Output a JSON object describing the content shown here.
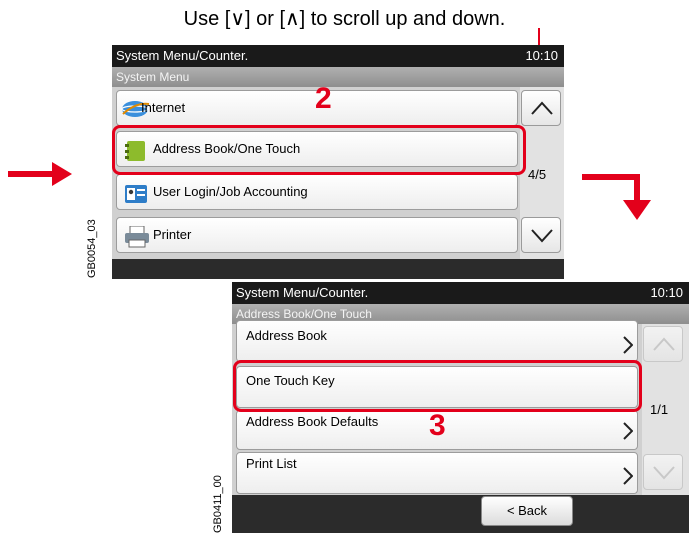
{
  "instruction": "Use [∨] or [∧] to scroll up and down.",
  "panel1": {
    "title": "System Menu/Counter.",
    "clock": "10:10",
    "subtitle": "System Menu",
    "items": [
      {
        "label": "Internet",
        "icon": "globe-icon"
      },
      {
        "label": "Address Book/One Touch",
        "icon": "address-book-icon"
      },
      {
        "label": "User Login/Job Accounting",
        "icon": "user-login-icon"
      },
      {
        "label": "Printer",
        "icon": "printer-icon"
      }
    ],
    "page": "4/5",
    "figure_id": "GB0054_03"
  },
  "panel2": {
    "title": "System Menu/Counter.",
    "clock": "10:10",
    "subtitle": "Address Book/One Touch",
    "items": [
      {
        "label": "Address Book"
      },
      {
        "label": "One Touch Key"
      },
      {
        "label": "Address Book Defaults"
      },
      {
        "label": "Print List"
      }
    ],
    "page": "1/1",
    "back_label": "< Back",
    "figure_id": "GB0411_00"
  },
  "steps": {
    "first": "2",
    "second": "3"
  },
  "colors": {
    "accent": "#e3001b",
    "titlebar": "#1a1a1a",
    "subbar": "#9a9a9a"
  }
}
